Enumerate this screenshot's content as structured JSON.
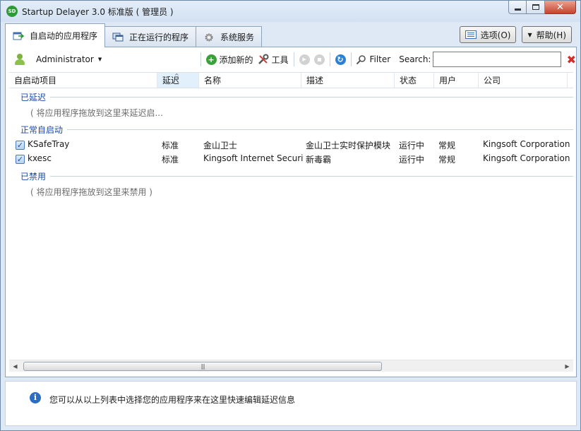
{
  "window": {
    "title": "Startup Delayer 3.0 标准版 ( 管理员 )",
    "app_icon": "SD"
  },
  "tabs": [
    {
      "label": "自启动的应用程序",
      "icon": "startup-apps-icon",
      "active": true
    },
    {
      "label": "正在运行的程序",
      "icon": "running-programs-icon",
      "active": false
    },
    {
      "label": "系统服务",
      "icon": "system-services-gear-icon",
      "active": false
    }
  ],
  "top_buttons": {
    "options": "选项(O)",
    "help": "帮助(H)"
  },
  "toolbar": {
    "user": "Administrator",
    "add_new": "添加新的",
    "tools": "工具",
    "filter": "Filter",
    "search_label": "Search:",
    "search_value": ""
  },
  "columns": [
    "自启动项目",
    "延迟",
    "名称",
    "描述",
    "状态",
    "用户",
    "公司"
  ],
  "groups": {
    "delayed": {
      "label": "已延迟",
      "hint": "( 将应用程序拖放到这里来延迟启..."
    },
    "normal": {
      "label": "正常自启动"
    },
    "disabled": {
      "label": "已禁用",
      "hint": "( 将应用程序拖放到这里来禁用 )"
    }
  },
  "rows": [
    {
      "item": "KSafeTray",
      "delay": "标准",
      "name": "金山卫士",
      "description": "金山卫士实时保护模块",
      "status": "运行中",
      "user": "常规",
      "company": "Kingsoft Corporation"
    },
    {
      "item": "kxesc",
      "delay": "标准",
      "name": "Kingsoft Internet Security",
      "description": "新毒霸",
      "status": "运行中",
      "user": "常规",
      "company": "Kingsoft Corporation"
    }
  ],
  "info": {
    "text": "您可以从以上列表中选择您的应用程序来在这里快速编辑延迟信息"
  },
  "colors": {
    "group_label": "#1e4aa8",
    "sorted_column": "#e1f0fb",
    "add_icon": "#3aa03a",
    "refresh_icon": "#2b7fd4",
    "clear_icon": "#d62b2b"
  }
}
